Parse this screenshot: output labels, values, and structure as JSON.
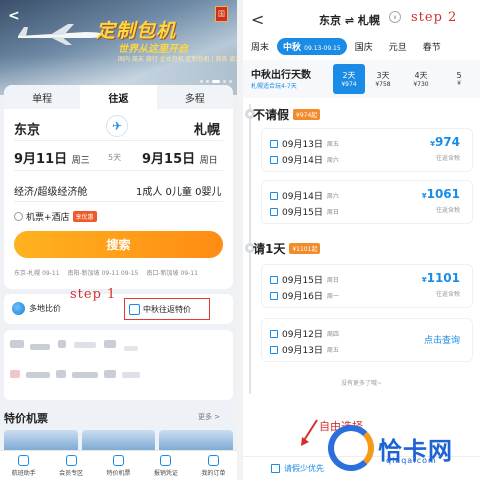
{
  "left": {
    "banner": {
      "title": "定制包机",
      "subtitle": "世界从这里开启",
      "tags": "国内 周末 旅行 企业包机 定制包机 | 商务 旅游 团体 会议",
      "badge": "国"
    },
    "tabs": [
      "单程",
      "往返",
      "多程"
    ],
    "active_tab": 1,
    "from_city": "东京",
    "to_city": "札幌",
    "out_date": "9月11日",
    "out_weekday": "周三",
    "trip_days": "5天",
    "in_date": "9月15日",
    "in_weekday": "周日",
    "cabin": "经济/超级经济舱",
    "passengers": "1成人 0儿童 0婴儿",
    "hotel_label": "机票+酒店",
    "hotel_tag": "享优惠",
    "search_label": "搜索",
    "history": [
      "东京-札幌 09-11",
      "南阳-新加坡 09-11 09-15",
      "南口-新加坡 09-11"
    ],
    "entry_multi": "多地比价",
    "entry_mid_autumn": "中秋往返特价",
    "step1": "step 1",
    "special_title": "特价机票",
    "more": "更多 >",
    "nav": [
      "航班助手",
      "会员专区",
      "特价机票",
      "报销凭证",
      "我的订单"
    ]
  },
  "right": {
    "back": "<",
    "title": "东京 ⇌ 札幌",
    "chev": "∨",
    "step2": "step 2",
    "holidays": [
      {
        "label": "周末",
        "sub": ""
      },
      {
        "label": "中秋",
        "sub": "09.13-09.15"
      },
      {
        "label": "国庆",
        "sub": ""
      },
      {
        "label": "元旦",
        "sub": ""
      },
      {
        "label": "春节",
        "sub": ""
      }
    ],
    "days_title": "中秋出行天数",
    "days_sub": "札幌适合玩4-7天",
    "day_options": [
      {
        "label": "2天",
        "price": "¥974"
      },
      {
        "label": "3天",
        "price": "¥758"
      },
      {
        "label": "4天",
        "price": "¥730"
      },
      {
        "label": "5",
        "price": "¥"
      }
    ],
    "sections": [
      {
        "title": "不请假",
        "tag": "¥974起"
      },
      {
        "title": "请1天",
        "tag": "¥1101起"
      }
    ],
    "cards": [
      {
        "d1": "09月13日",
        "w1": "周五",
        "d2": "09月14日",
        "w2": "周六",
        "price": "974",
        "label": "往返含税"
      },
      {
        "d1": "09月14日",
        "w1": "周六",
        "d2": "09月15日",
        "w2": "周日",
        "price": "1061",
        "label": "往返含税"
      },
      {
        "d1": "09月15日",
        "w1": "周日",
        "d2": "09月16日",
        "w2": "周一",
        "price": "1101",
        "label": "往返含税"
      },
      {
        "d1": "09月12日",
        "w1": "周四",
        "d2": "09月13日",
        "w2": "周五",
        "price": "",
        "label": "点击查询"
      }
    ],
    "currency": "¥",
    "no_more": "没有更多了哦~",
    "pick_label": "自由选择",
    "bottom_label": "请假少优先",
    "watermark": "恰卡网",
    "watermark_url": "qiaqa.com"
  }
}
